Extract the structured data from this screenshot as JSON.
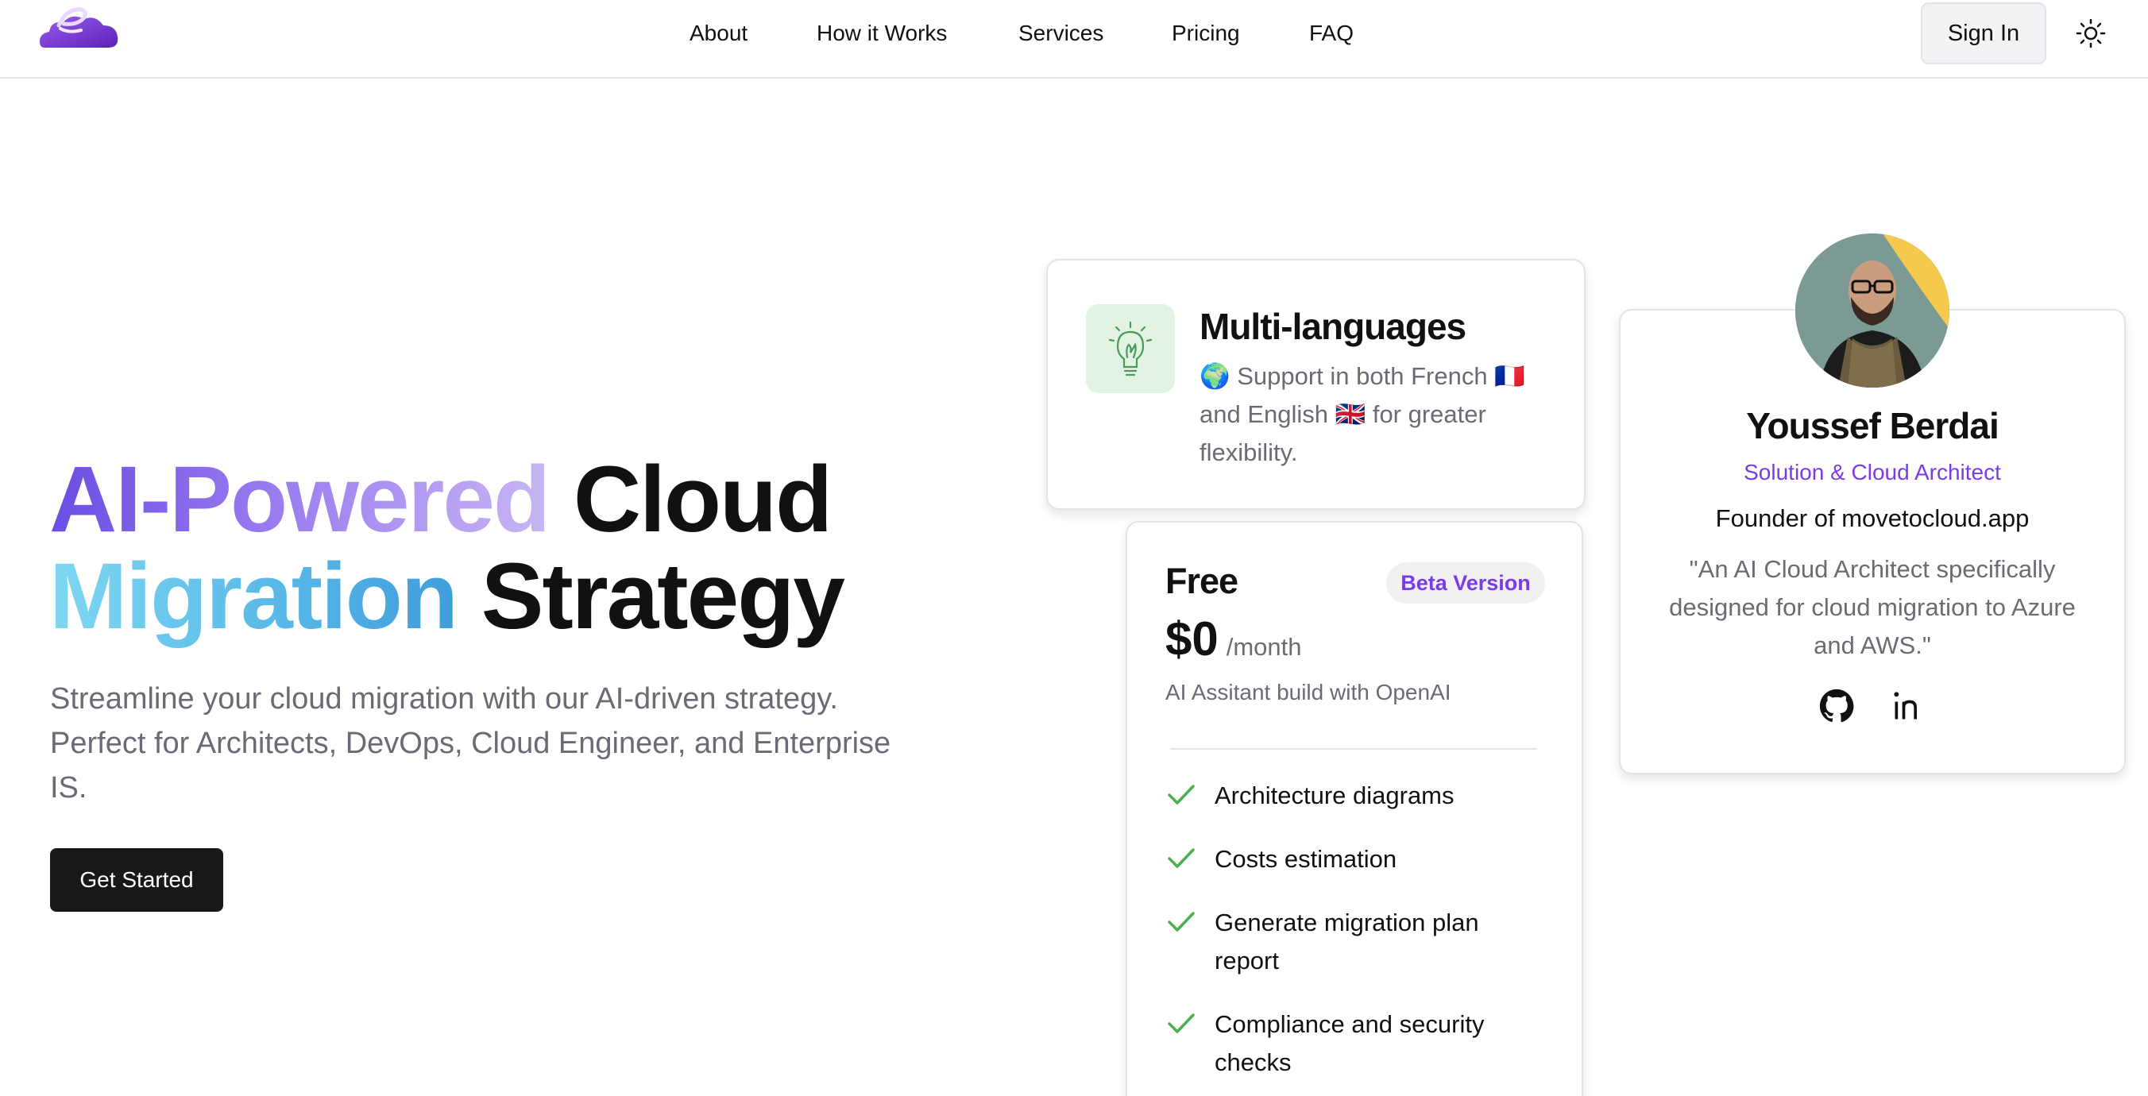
{
  "header": {
    "nav": [
      "About",
      "How it Works",
      "Services",
      "Pricing",
      "FAQ"
    ],
    "sign_in": "Sign In"
  },
  "hero": {
    "title_part1": "AI-Powered",
    "title_part2": "Cloud",
    "title_part3": "Migration",
    "title_part4": "Strategy",
    "subtitle": "Streamline your cloud migration with our AI-driven strategy. Perfect for Architects, DevOps, Cloud Engineer, and Enterprise IS.",
    "cta": "Get Started"
  },
  "feature_card": {
    "title": "Multi-languages",
    "description": "🌍 Support in both French 🇫🇷 and English 🇬🇧 for greater flexibility."
  },
  "pricing": {
    "plan": "Free",
    "badge": "Beta Version",
    "price": "$0",
    "period": "/month",
    "description": "AI Assitant build with OpenAI",
    "features": [
      "Architecture diagrams",
      "Costs estimation",
      "Generate migration plan report",
      "Compliance and security checks"
    ]
  },
  "founder": {
    "name": "Youssef Berdai",
    "role": "Solution & Cloud Architect",
    "company": "Founder of movetocloud.app",
    "quote": "\"An AI Cloud Architect specifically designed for cloud migration to Azure and AWS.\""
  },
  "colors": {
    "accent_purple": "#7c3aed",
    "check_green": "#4caf50",
    "button_dark": "#18181b"
  },
  "icons": {
    "logo": "cloud-e-logo",
    "theme": "sun-icon",
    "feature": "lightbulb-icon",
    "check": "check-icon",
    "github": "github-icon",
    "linkedin": "linkedin-icon"
  }
}
